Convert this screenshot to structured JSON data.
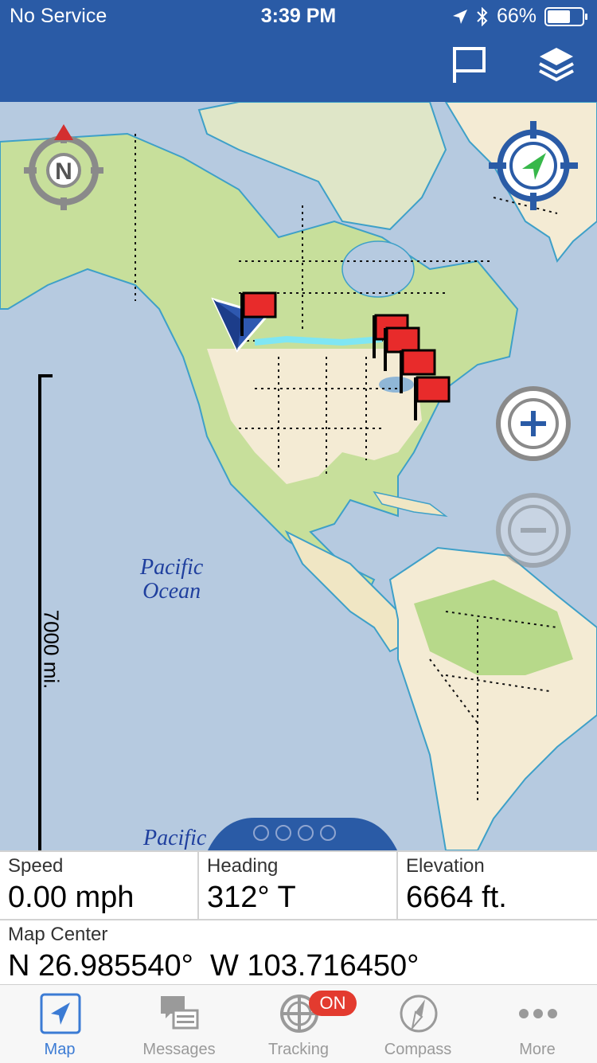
{
  "status_bar": {
    "carrier": "No Service",
    "time": "3:39 PM",
    "battery": "66%",
    "battery_level": 0.66
  },
  "header": {
    "flag_icon": "flag-icon",
    "layers_icon": "layers-icon",
    "color": "#2a5ba6"
  },
  "map": {
    "scale_label": "7000 mi.",
    "ocean_label_1": "Pacific\nOcean",
    "ocean_label_2": "Pacific",
    "compass_letter": "N",
    "waypoint_color": "#e82b2b",
    "track_color": "#7fe6f3"
  },
  "info": {
    "speed": {
      "label": "Speed",
      "value": "0.00 mph"
    },
    "heading": {
      "label": "Heading",
      "value": "312° T"
    },
    "elevation": {
      "label": "Elevation",
      "value": "6664 ft."
    },
    "map_center": {
      "label": "Map Center",
      "value": "N 26.985540°  W 103.716450°"
    }
  },
  "tabs": [
    {
      "label": "Map",
      "icon": "map-navigation-icon",
      "active": true
    },
    {
      "label": "Messages",
      "icon": "messages-icon",
      "active": false
    },
    {
      "label": "Tracking",
      "icon": "tracking-icon",
      "active": false
    },
    {
      "label": "Compass",
      "icon": "compass-icon",
      "active": false
    },
    {
      "label": "More",
      "icon": "more-icon",
      "active": false
    }
  ],
  "tracking_badge": "ON"
}
